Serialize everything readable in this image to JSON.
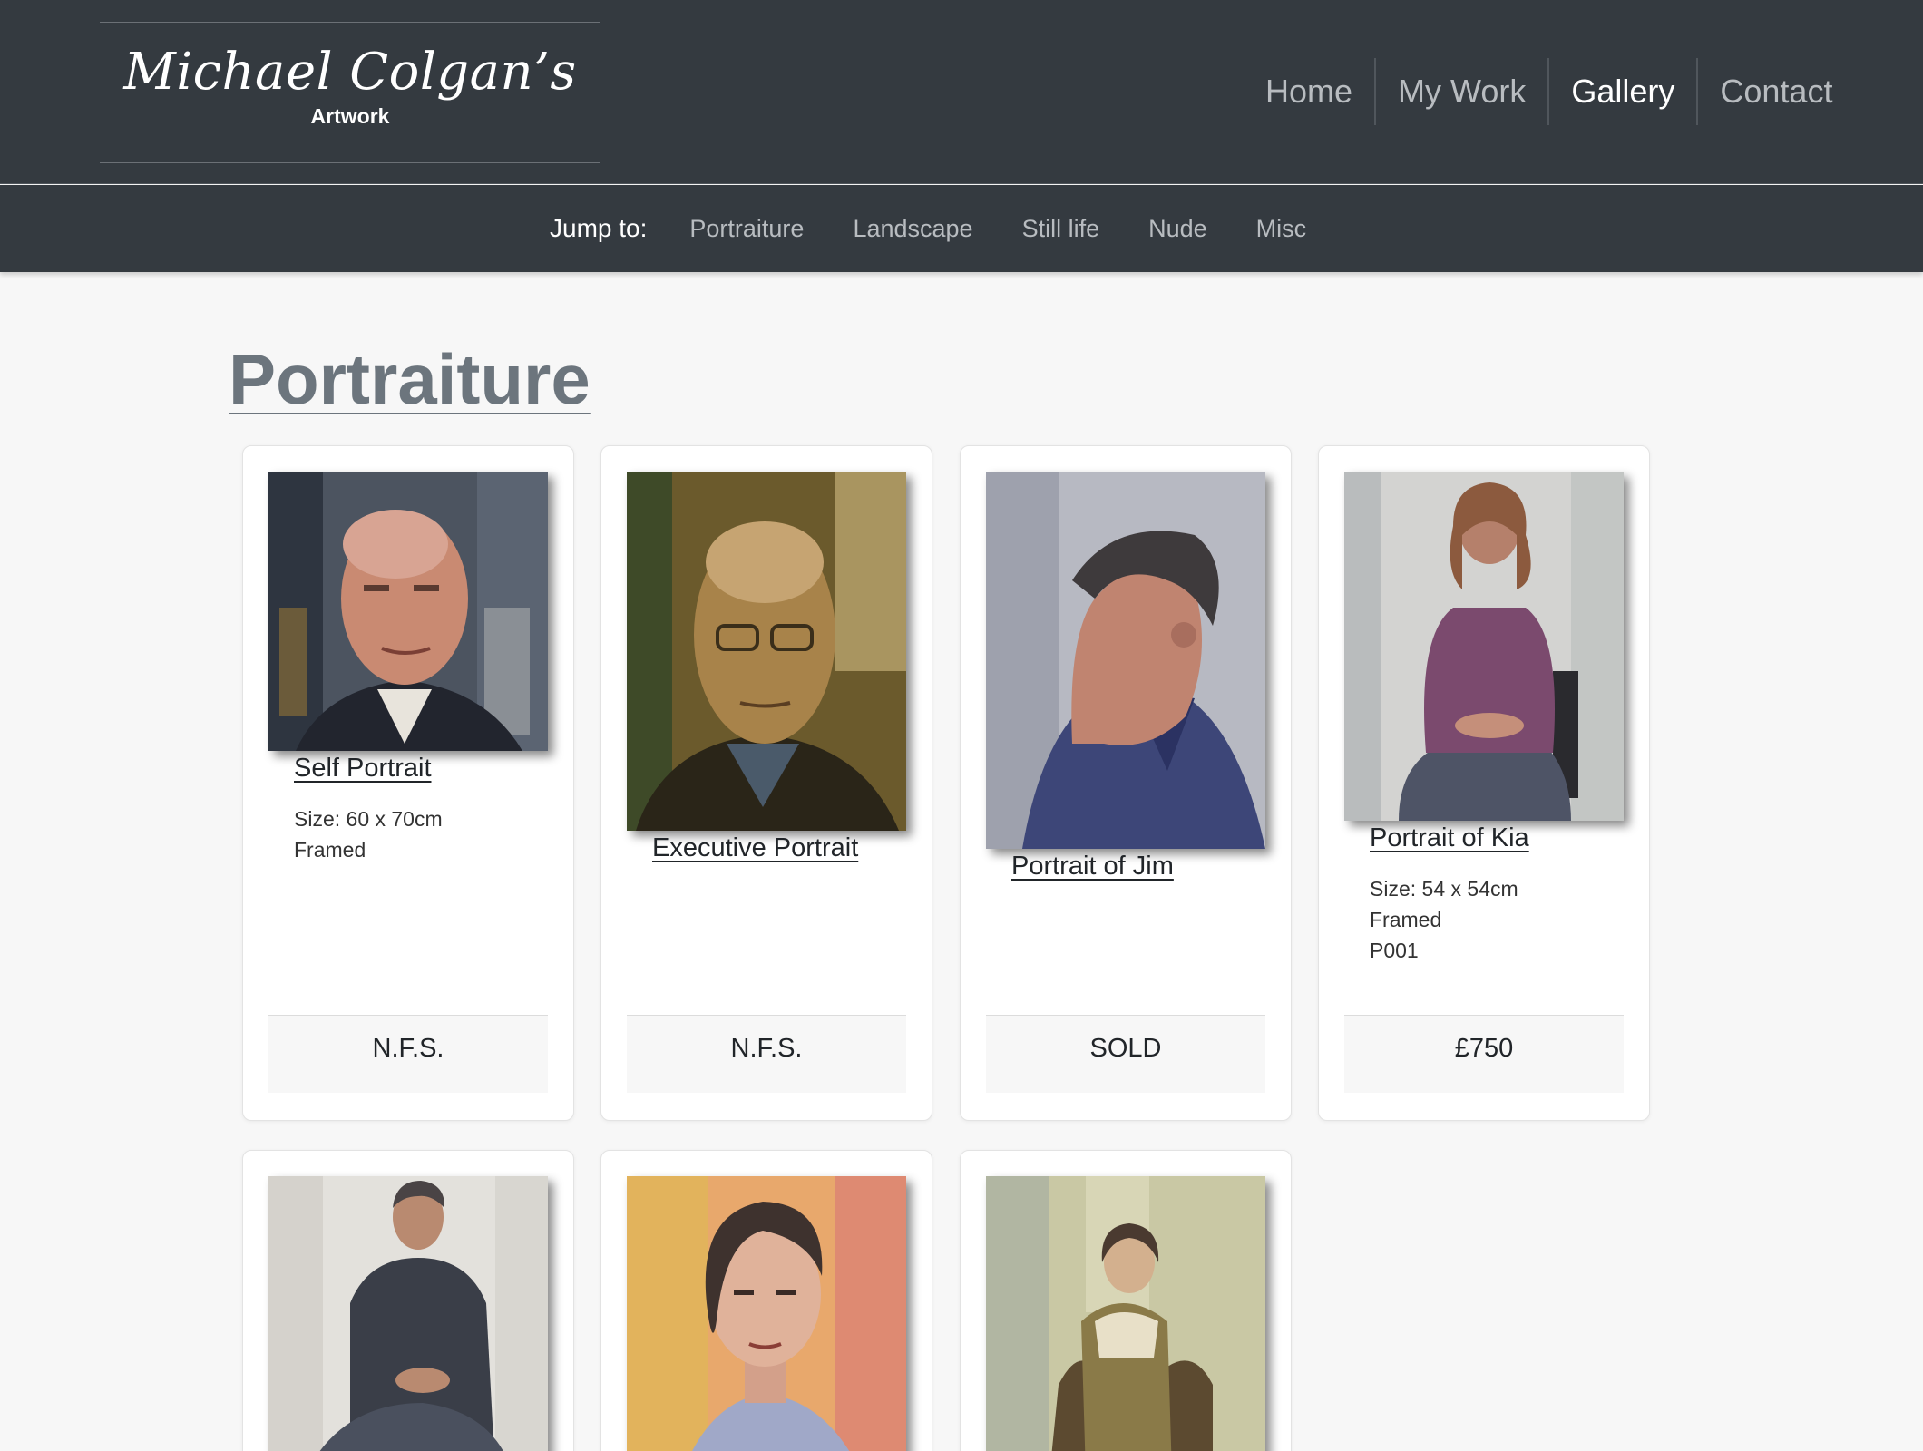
{
  "brand": {
    "name": "Michael Colgan’s",
    "subtitle": "Artwork"
  },
  "nav": {
    "home": "Home",
    "my_work": "My Work",
    "gallery": "Gallery",
    "contact": "Contact"
  },
  "subnav": {
    "jump_label": "Jump to:",
    "items": [
      "Portraiture",
      "Landscape",
      "Still life",
      "Nude",
      "Misc"
    ]
  },
  "section": {
    "title": "Portraiture"
  },
  "cards": [
    {
      "title": "Self Portrait",
      "size": "Size: 60 x 70cm",
      "frame": "Framed",
      "price": "N.F.S."
    },
    {
      "title": "Executive Portrait",
      "price": "N.F.S."
    },
    {
      "title": "Portrait of Jim",
      "price": "SOLD"
    },
    {
      "title": "Portrait of Kia",
      "size": "Size: 54 x 54cm",
      "frame": "Framed",
      "code": "P001",
      "price": "£750"
    }
  ],
  "colors": {
    "header_bg": "#343a40",
    "nav_muted": "#b8bcc0",
    "title_grey": "#6c757d",
    "page_bg": "#f7f7f7"
  }
}
